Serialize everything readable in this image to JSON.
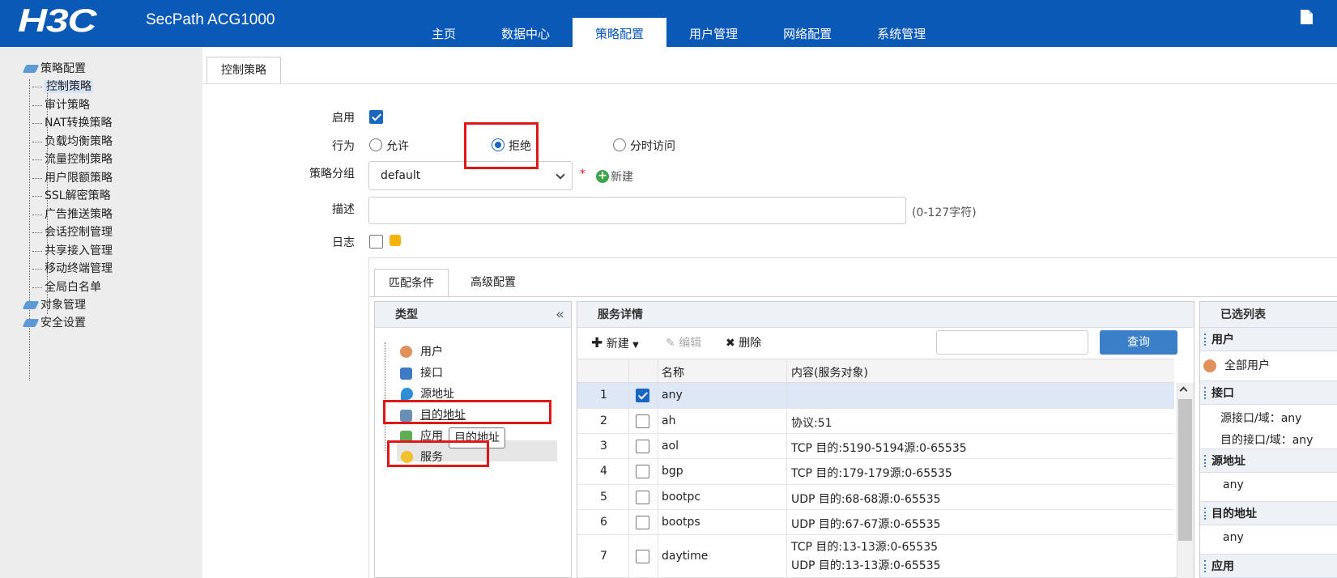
{
  "header": {
    "logo": "H3C",
    "product": "SecPath ACG1000",
    "nav": [
      "主页",
      "数据中心",
      "策略配置",
      "用户管理",
      "网络配置",
      "系统管理"
    ],
    "active_nav": "策略配置"
  },
  "sidebar": {
    "groups": [
      {
        "label": "策略配置",
        "children": [
          "控制策略",
          "审计策略",
          "NAT转换策略",
          "负载均衡策略",
          "流量控制策略",
          "用户限额策略",
          "SSL解密策略",
          "广告推送策略",
          "会话控制管理",
          "共享接入管理",
          "移动终端管理",
          "全局白名单"
        ]
      },
      {
        "label": "对象管理"
      },
      {
        "label": "安全设置"
      }
    ],
    "selected": "控制策略"
  },
  "main_tab": "控制策略",
  "form": {
    "enable_label": "启用",
    "enable_checked": true,
    "action_label": "行为",
    "action_options": [
      "允许",
      "拒绝",
      "分时访问"
    ],
    "action_selected": "拒绝",
    "group_label": "策略分组",
    "group_value": "default",
    "required_mark": "*",
    "new_label": "新建",
    "desc_label": "描述",
    "desc_value": "",
    "desc_hint": "(0-127字符)",
    "log_label": "日志",
    "log_checked": false
  },
  "sub_tabs": [
    "匹配条件",
    "高级配置"
  ],
  "type_panel": {
    "title": "类型",
    "collapse_glyph": "«",
    "items": [
      "用户",
      "接口",
      "源地址",
      "目的地址",
      "应用",
      "服务"
    ],
    "selected": "服务",
    "tooltip": "目的地址"
  },
  "service_panel": {
    "title": "服务详情",
    "toolbar": {
      "new": "新建",
      "edit": "编辑",
      "delete": "删除",
      "query": "查询",
      "search_value": ""
    },
    "columns": [
      "名称",
      "内容(服务对象)"
    ],
    "rows": [
      {
        "no": "1",
        "checked": true,
        "name": "any",
        "content": ""
      },
      {
        "no": "2",
        "checked": false,
        "name": "ah",
        "content": "协议:51"
      },
      {
        "no": "3",
        "checked": false,
        "name": "aol",
        "content": "TCP 目的:5190-5194源:0-65535"
      },
      {
        "no": "4",
        "checked": false,
        "name": "bgp",
        "content": "TCP 目的:179-179源:0-65535"
      },
      {
        "no": "5",
        "checked": false,
        "name": "bootpc",
        "content": "UDP 目的:68-68源:0-65535"
      },
      {
        "no": "6",
        "checked": false,
        "name": "bootps",
        "content": "UDP 目的:67-67源:0-65535"
      },
      {
        "no": "7",
        "checked": false,
        "name": "daytime",
        "content": "TCP 目的:13-13源:0-65535",
        "content2": "UDP 目的:13-13源:0-65535"
      }
    ]
  },
  "selected_panel": {
    "title": "已选列表",
    "user_label": "用户",
    "user_value": "全部用户",
    "iface_label": "接口",
    "src_iface": "源接口/域：any",
    "dst_iface": "目的接口/域：any",
    "src_addr_label": "源地址",
    "src_addr_value": "any",
    "dst_addr_label": "目的地址",
    "dst_addr_value": "any",
    "app_label": "应用"
  },
  "colors": {
    "brand": "#0b59b7",
    "highlight": "#e01717",
    "checkbox": "#1867c0"
  }
}
